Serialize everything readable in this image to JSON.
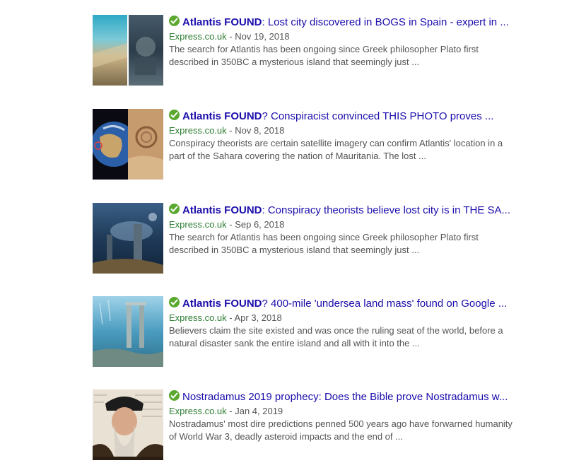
{
  "results": [
    {
      "title_bold": "Atlantis FOUND",
      "title_rest": ": Lost city discovered in BOGS in Spain - expert in ...",
      "source": "Express.co.uk",
      "date": " - Nov 19, 2018",
      "snippet_1": "The search for Atlantis has been ongoing since Greek philosopher Plato first",
      "snippet_2": "described in 350BC a mysterious island that seemingly just ..."
    },
    {
      "title_bold": "Atlantis FOUND",
      "title_rest": "? Conspiracist convinced THIS PHOTO proves ...",
      "source": "Express.co.uk",
      "date": " - Nov 8, 2018",
      "snippet_1": "Conspiracy theorists are certain satellite imagery can confirm Atlantis' location in a",
      "snippet_2": "part of the Sahara covering the nation of Mauritania. The lost ..."
    },
    {
      "title_bold": "Atlantis FOUND",
      "title_rest": ": Conspiracy theorists believe lost city is in THE SA...",
      "source": "Express.co.uk",
      "date": " - Sep 6, 2018",
      "snippet_1": "The search for Atlantis has been ongoing since Greek philosopher Plato first",
      "snippet_2": "described in 350BC a mysterious island that seemingly just ..."
    },
    {
      "title_bold": "Atlantis FOUND",
      "title_rest": "? 400-mile 'undersea land mass' found on Google ...",
      "source": "Express.co.uk",
      "date": " - Apr 3, 2018",
      "snippet_1": "Believers claim the site existed and was once the ruling seat of the world, before a",
      "snippet_2": "natural disaster sank the entire island and all with it into the ..."
    },
    {
      "title_bold": "",
      "title_rest": "Nostradamus 2019 prophecy: Does the Bible prove Nostradamus w...",
      "source": "Express.co.uk",
      "date": " - Jan 4, 2019",
      "snippet_1": "Nostradamus' most dire predictions penned 500 years ago have forwarned humanity",
      "snippet_2": "of World War 3, deadly asteroid impacts and the end of ..."
    }
  ],
  "icons": {
    "verified": "checkmark-circle-icon"
  },
  "colors": {
    "link": "#1a0dab",
    "source": "#2e7d32",
    "verified": "#5aa830"
  }
}
